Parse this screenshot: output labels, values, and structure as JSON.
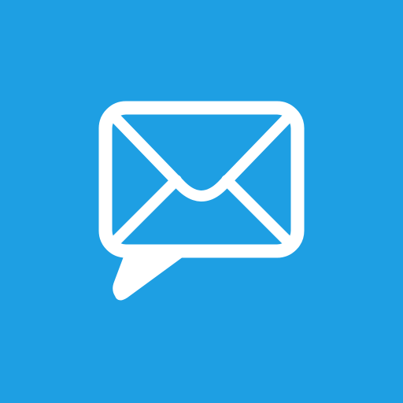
{
  "icon": {
    "name": "mail-chat-icon",
    "background_color": "#1e9fe3",
    "glyph_color": "#ffffff"
  }
}
